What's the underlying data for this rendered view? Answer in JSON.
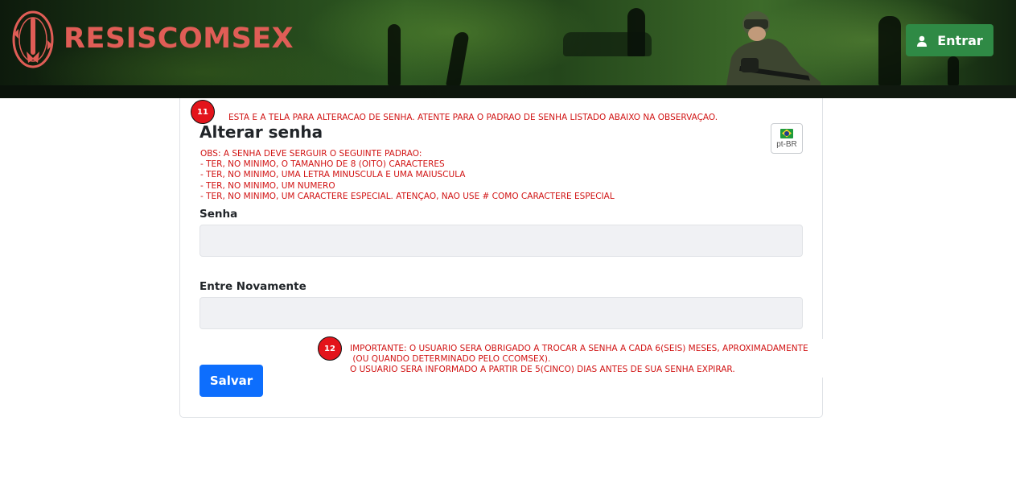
{
  "header": {
    "brand": "RESISCOMSEX",
    "login_label": "Entrar"
  },
  "card": {
    "title": "Alterar senha",
    "language": "pt-BR",
    "observation": "OBS: A SENHA DEVE SERGUIR O SEGUINTE PADRAO:\n- TER, NO MINIMO, O TAMANHO DE 8 (OITO) CARACTERES\n- TER, NO MINIMO, UMA LETRA MINUSCULA E UMA MAIUSCULA\n- TER, NO MINIMO, UM NUMERO\n- TER, NO MINIMO, UM CARACTERE ESPECIAL. ATENÇAO, NAO USE # COMO CARACTERE ESPECIAL",
    "password_label": "Senha",
    "password_value": "",
    "confirm_label": "Entre Novamente",
    "confirm_value": "",
    "save_label": "Salvar"
  },
  "annotations": {
    "top": {
      "number": "11",
      "text": "ESTA E A TELA PARA ALTERACAO DE SENHA. ATENTE PARA O PADRAO DE SENHA LISTADO ABAIXO NA OBSERVAÇAO."
    },
    "bottom": {
      "number": "12",
      "text": "IMPORTANTE: O USUARIO SERA OBRIGADO A TROCAR A SENHA A CADA 6(SEIS) MESES, APROXIMADAMENTE\n (OU QUANDO DETERMINADO PELO CCOMSEX).\nO USUARIO SERA INFORMADO A PARTIR DE 5(CINCO) DIAS ANTES DE SUA SENHA EXPIRAR."
    }
  },
  "colors": {
    "brand": "#e05d56",
    "login_button": "#2f8a45",
    "save_button": "#0d6efd",
    "annotation_red": "#d11313",
    "badge_red": "#e3141b"
  },
  "icons": {
    "logo": "resiscomsex-logo",
    "user": "user-icon",
    "flag": "brazil-flag-icon"
  }
}
